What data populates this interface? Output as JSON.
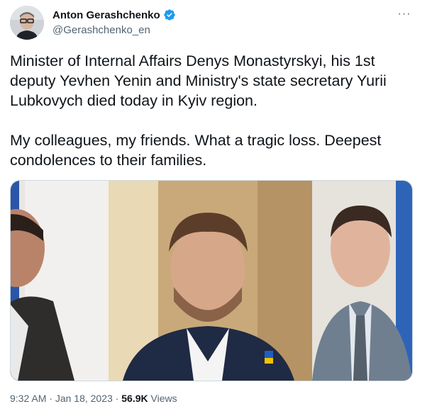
{
  "author": {
    "name": "Anton Gerashchenko",
    "handle": "@Gerashchenko_en",
    "verified_icon": "verified-badge-icon"
  },
  "more_icon": "more-options-icon",
  "more_label": "···",
  "tweet": {
    "paragraph_1": "Minister of Internal Affairs Denys Monastyrskyi, his 1st deputy Yevhen Yenin and Ministry's state secretary Yurii Lubkovych died today in Kyiv region.",
    "paragraph_2": "My colleagues, my friends. What a tragic loss. Deepest condolences to their families."
  },
  "media": {
    "photo_count": 3
  },
  "meta": {
    "time": "9:32 AM",
    "sep1": " · ",
    "date": "Jan 18, 2023",
    "sep2": " · ",
    "views_count": "56.9K",
    "views_label": " Views"
  },
  "colors": {
    "verified_blue": "#1d9bf0",
    "secondary_text": "#536471",
    "primary_text": "#0f1419"
  }
}
